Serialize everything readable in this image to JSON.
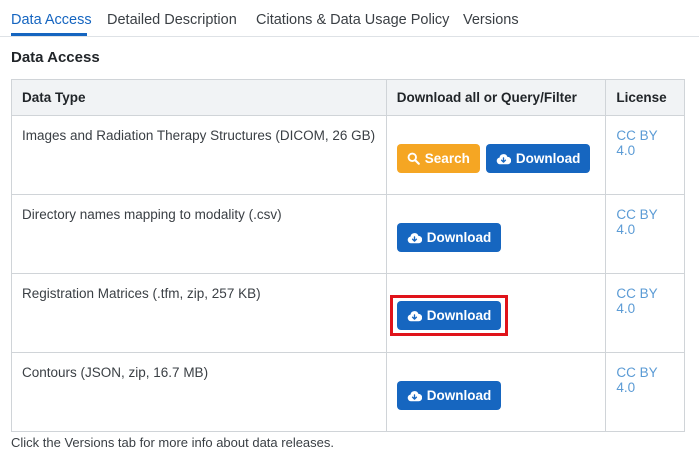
{
  "tabs": [
    {
      "label": "Data Access",
      "active": true
    },
    {
      "label": "Detailed Description",
      "active": false
    },
    {
      "label": "Citations & Data Usage Policy",
      "active": false
    },
    {
      "label": "Versions",
      "active": false
    }
  ],
  "section_title": "Data Access",
  "table": {
    "headers": [
      "Data Type",
      "Download all or Query/Filter",
      "License"
    ],
    "rows": [
      {
        "data_type": "Images and Radiation Therapy Structures (DICOM, 26 GB)",
        "search_label": "Search",
        "download_label": "Download",
        "license": "CC BY 4.0"
      },
      {
        "data_type": "Directory names mapping to modality (.csv)",
        "download_label": "Download",
        "license": "CC BY 4.0"
      },
      {
        "data_type": "Registration Matrices (.tfm, zip, 257 KB)",
        "download_label": "Download",
        "license": "CC BY 4.0",
        "highlighted": true
      },
      {
        "data_type": "Contours (JSON, zip, 16.7 MB)",
        "download_label": "Download",
        "license": "CC BY 4.0"
      }
    ]
  },
  "footnote": "Click the Versions tab for more info about data releases.",
  "icons": {
    "search": "search-icon",
    "download": "cloud-download-icon"
  },
  "colors": {
    "accent": "#1565c0",
    "download_button": "#1666c0",
    "search_button": "#f5a623",
    "license_link": "#5b9bd5",
    "highlight_box": "#e0131a"
  }
}
